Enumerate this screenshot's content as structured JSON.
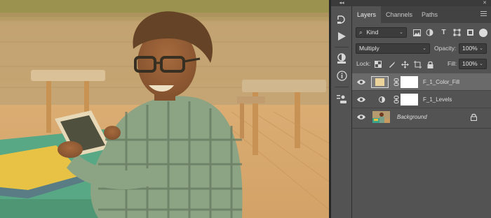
{
  "panel": {
    "collapse_left": "◂◂",
    "collapse_right": "✕",
    "tabs": [
      {
        "label": "Layers",
        "active": true
      },
      {
        "label": "Channels",
        "active": false
      },
      {
        "label": "Paths",
        "active": false
      }
    ],
    "filter": {
      "kind_label": "Kind",
      "icons": [
        "image-filter-icon",
        "adjustment-filter-icon",
        "type-filter-icon",
        "shape-filter-icon",
        "smart-object-filter-icon"
      ]
    },
    "blend_mode": "Multiply",
    "opacity_label": "Opacity:",
    "opacity_value": "100%",
    "lock_label": "Lock:",
    "fill_label": "Fill:",
    "fill_value": "100%",
    "layers": [
      {
        "name": "F_1_Color_Fill",
        "type": "fill",
        "selected": true,
        "visible": true,
        "swatch_color": "#ecd39a"
      },
      {
        "name": "F_1_Levels",
        "type": "adjustment",
        "selected": false,
        "visible": true
      },
      {
        "name": "Background",
        "type": "background",
        "selected": false,
        "visible": true,
        "locked": true
      }
    ]
  },
  "tools": [
    "history-icon",
    "play-action-icon",
    "adjustments-icon",
    "info-icon",
    "properties-icon"
  ],
  "colors": {
    "panel_bg": "#535353",
    "tab_bar_bg": "#424242",
    "selected_layer": "#6a6a6a",
    "photo_tint": "#d7b57f"
  }
}
